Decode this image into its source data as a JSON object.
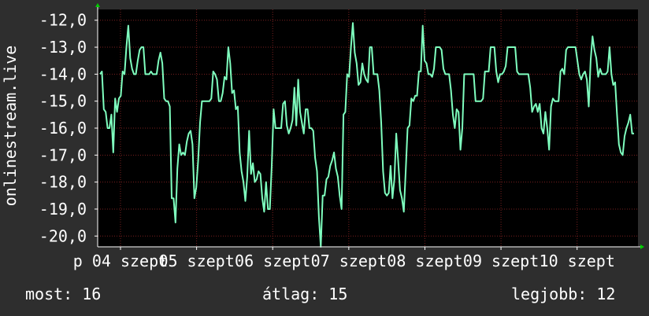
{
  "colors": {
    "background": "#2e2e2e",
    "plot_background": "#000000",
    "line": "#7fffbf",
    "grid": "#7a2020",
    "axis": "#ffffff",
    "arrow": "#00cc00"
  },
  "chart_data": {
    "type": "line",
    "ylabel": "onlinestream.live",
    "y_tick_labels": [
      "-12,0",
      "-13,0",
      "-14,0",
      "-15,0",
      "-16,0",
      "-17,0",
      "-18,0",
      "-19,0",
      "-20,0"
    ],
    "y_ticks": [
      -12,
      -13,
      -14,
      -15,
      -16,
      -17,
      -18,
      -19,
      -20
    ],
    "ylim": [
      -20.4,
      -11.6
    ],
    "x_tick_labels": [
      "p 04 szept",
      "05 szept",
      "06 szept",
      "07 szept",
      "08 szept",
      "09 szept",
      "10 szept"
    ],
    "x_ticks": [
      0,
      1,
      2,
      3,
      4,
      5,
      6
    ],
    "xlim": [
      -0.3,
      6.8
    ],
    "grid": true,
    "series": [
      {
        "values": [
          -14.0,
          -13.9,
          -15.3,
          -15.4,
          -16.0,
          -16.0,
          -15.5,
          -16.9,
          -14.9,
          -15.4,
          -14.9,
          -14.8,
          -13.9,
          -14.0,
          -13.0,
          -12.2,
          -13.4,
          -13.8,
          -14.0,
          -14.0,
          -13.5,
          -13.1,
          -13.0,
          -13.0,
          -14.0,
          -14.0,
          -14.0,
          -13.9,
          -14.0,
          -14.0,
          -14.0,
          -13.5,
          -13.2,
          -13.6,
          -14.9,
          -15.0,
          -15.0,
          -15.2,
          -18.6,
          -18.6,
          -19.5,
          -17.5,
          -16.6,
          -17.0,
          -16.9,
          -17.0,
          -16.5,
          -16.2,
          -16.1,
          -16.6,
          -18.6,
          -18.2,
          -17.2,
          -15.8,
          -15.0,
          -15.0,
          -15.0,
          -15.0,
          -15.0,
          -14.9,
          -13.9,
          -14.0,
          -14.2,
          -15.0,
          -15.0,
          -14.7,
          -14.1,
          -14.2,
          -13.0,
          -13.6,
          -14.7,
          -14.6,
          -15.3,
          -15.2,
          -16.9,
          -17.6,
          -18.0,
          -18.7,
          -17.8,
          -16.1,
          -17.7,
          -17.3,
          -18.0,
          -17.9,
          -17.6,
          -17.7,
          -18.6,
          -19.1,
          -18.0,
          -19.0,
          -19.0,
          -17.4,
          -15.3,
          -16.0,
          -16.0,
          -16.0,
          -16.0,
          -15.1,
          -15.0,
          -15.9,
          -16.2,
          -16.0,
          -15.7,
          -14.5,
          -15.9,
          -14.2,
          -15.4,
          -15.8,
          -16.2,
          -15.3,
          -15.3,
          -16.0,
          -16.0,
          -16.1,
          -17.1,
          -17.6,
          -19.3,
          -20.4,
          -18.5,
          -18.5,
          -17.9,
          -17.8,
          -17.4,
          -17.2,
          -16.9,
          -17.5,
          -17.8,
          -18.5,
          -19.0,
          -15.5,
          -15.4,
          -14.0,
          -14.1,
          -13.0,
          -12.1,
          -13.2,
          -13.6,
          -14.4,
          -14.3,
          -13.6,
          -14.0,
          -14.2,
          -14.3,
          -13.0,
          -13.0,
          -14.0,
          -14.0,
          -14.0,
          -14.6,
          -15.8,
          -17.6,
          -18.4,
          -18.5,
          -18.4,
          -17.4,
          -18.6,
          -17.9,
          -16.2,
          -17.2,
          -18.3,
          -18.6,
          -19.1,
          -17.6,
          -16.0,
          -15.9,
          -14.9,
          -15.0,
          -14.8,
          -14.8,
          -13.9,
          -13.9,
          -12.2,
          -13.5,
          -13.6,
          -14.0,
          -14.0,
          -14.1,
          -13.8,
          -13.0,
          -13.0,
          -13.0,
          -13.1,
          -13.8,
          -14.0,
          -14.0,
          -14.0,
          -14.6,
          -15.5,
          -16.0,
          -15.3,
          -15.4,
          -16.8,
          -16.0,
          -14.0,
          -14.0,
          -14.0,
          -14.0,
          -14.0,
          -14.0,
          -15.0,
          -15.0,
          -15.0,
          -15.0,
          -14.9,
          -13.9,
          -13.9,
          -13.9,
          -13.0,
          -13.0,
          -13.0,
          -13.9,
          -14.3,
          -14.0,
          -14.0,
          -13.9,
          -13.7,
          -13.0,
          -13.0,
          -13.0,
          -13.0,
          -13.0,
          -13.9,
          -14.0,
          -14.0,
          -14.0,
          -14.0,
          -14.0,
          -14.0,
          -14.5,
          -15.4,
          -15.2,
          -15.1,
          -15.4,
          -15.1,
          -16.0,
          -16.2,
          -15.4,
          -16.0,
          -16.8,
          -15.2,
          -14.9,
          -15.0,
          -15.0,
          -15.0,
          -13.9,
          -13.8,
          -14.0,
          -13.1,
          -13.0,
          -13.0,
          -13.0,
          -13.0,
          -13.0,
          -13.5,
          -14.0,
          -14.2,
          -14.0,
          -13.9,
          -14.2,
          -15.2,
          -13.5,
          -12.6,
          -13.1,
          -13.4,
          -14.1,
          -13.8,
          -14.0,
          -14.0,
          -14.0,
          -13.9,
          -13.0,
          -14.0,
          -14.4,
          -14.3,
          -15.5,
          -16.6,
          -16.9,
          -17.0,
          -16.3,
          -16.0,
          -15.8,
          -15.5,
          -16.2,
          -16.2
        ]
      }
    ]
  },
  "stats": {
    "now": "most: 16",
    "avg": "átlag: 15",
    "best": "legjobb: 12"
  }
}
